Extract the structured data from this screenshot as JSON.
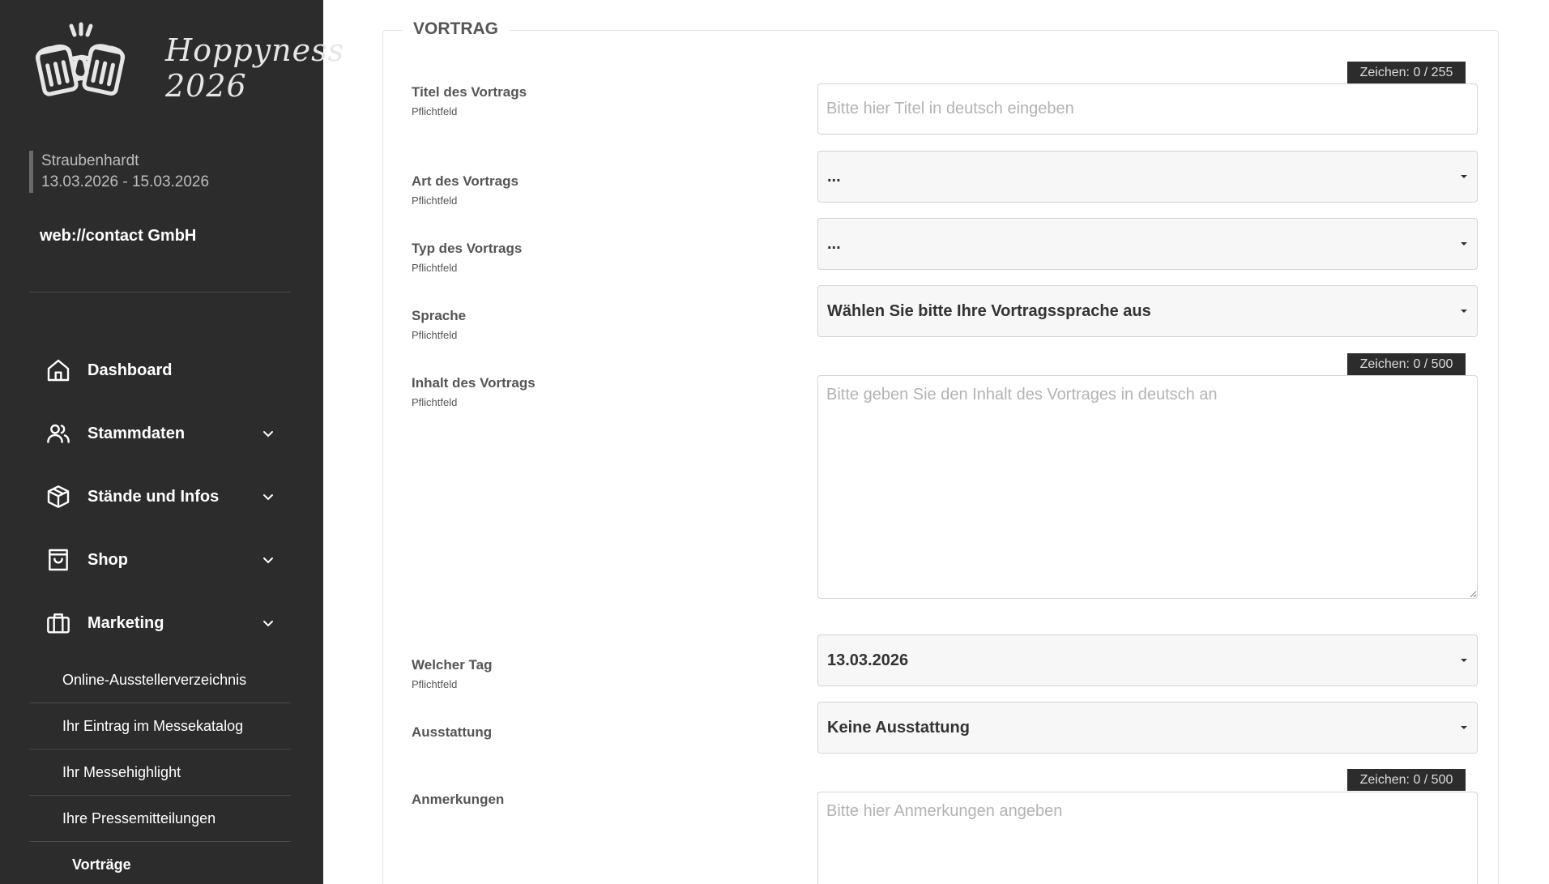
{
  "sidebar": {
    "logo_text_line1": "Hoppyness",
    "logo_text_line2": "2026",
    "event_city": "Straubenhardt",
    "event_dates": "13.03.2026 - 15.03.2026",
    "company": "web://contact GmbH",
    "nav": [
      {
        "label": "Dashboard",
        "icon": "home-icon"
      },
      {
        "label": "Stammdaten",
        "icon": "users-icon"
      },
      {
        "label": "Stände und Infos",
        "icon": "box-icon"
      },
      {
        "label": "Shop",
        "icon": "shopping-bag-icon"
      },
      {
        "label": "Marketing",
        "icon": "briefcase-icon"
      }
    ],
    "marketing_sub": [
      {
        "label": "Online-Ausstellerverzeichnis"
      },
      {
        "label": "Ihr Eintrag im Messekatalog"
      },
      {
        "label": "Ihr Messehighlight"
      },
      {
        "label": "Ihre Pressemitteilungen"
      },
      {
        "label": "Vorträge"
      }
    ]
  },
  "form": {
    "legend": "VORTRAG",
    "required_text": "Pflichtfeld",
    "title": {
      "label": "Titel des Vortrags",
      "counter": "Zeichen: 0 / 255",
      "placeholder": "Bitte hier Titel in deutsch eingeben",
      "value": ""
    },
    "art": {
      "label": "Art des Vortrags",
      "selected": "..."
    },
    "typ": {
      "label": "Typ des Vortrags",
      "selected": "..."
    },
    "sprache": {
      "label": "Sprache",
      "selected": "Wählen Sie bitte Ihre Vortragssprache aus"
    },
    "inhalt": {
      "label": "Inhalt des Vortrags",
      "counter": "Zeichen: 0 / 500",
      "placeholder": "Bitte geben Sie den Inhalt des Vortrages in deutsch an",
      "value": ""
    },
    "tag": {
      "label": "Welcher Tag",
      "selected": "13.03.2026"
    },
    "ausstattung": {
      "label": "Ausstattung",
      "selected": "Keine Ausstattung"
    },
    "anmerkungen": {
      "label": "Anmerkungen",
      "counter": "Zeichen: 0 / 500",
      "placeholder": "Bitte hier Anmerkungen angeben",
      "value": ""
    }
  },
  "colors": {
    "sidebar_bg": "#2c2c2c",
    "counter_bg": "#2c2c2c",
    "select_bg": "#f7f7f7"
  }
}
